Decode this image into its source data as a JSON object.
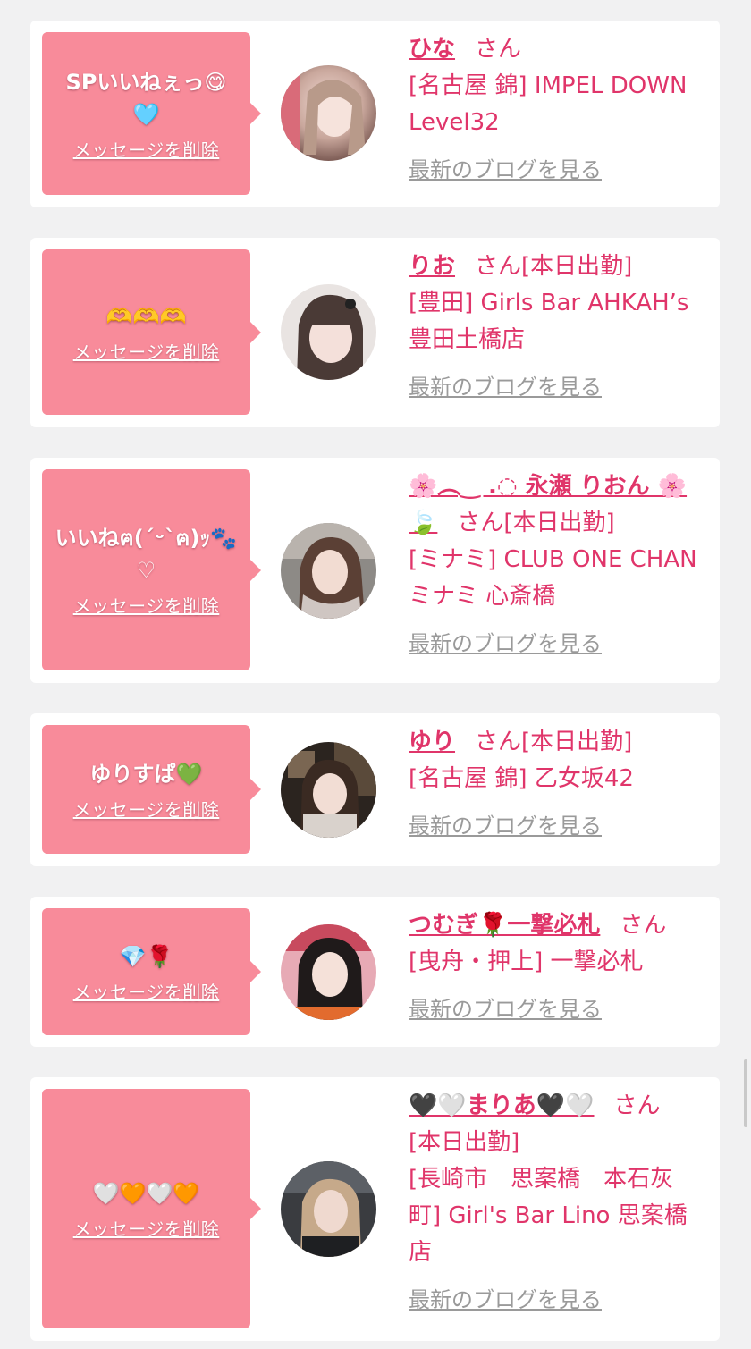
{
  "delete_label": "メッセージを削除",
  "blog_label": "最新のブログを見る",
  "san_label": "さん",
  "colors": {
    "accent": "#e0356a",
    "bubble": "#f88b9a",
    "background": "#f1f1f2"
  },
  "items": [
    {
      "message": "SPいいねぇっ😋🩵",
      "name": "ひな",
      "status": "",
      "shop": "[名古屋 錦] IMPEL DOWN Level32"
    },
    {
      "message": "🫶🫶🫶",
      "name": "りお",
      "status": "[本日出勤]",
      "shop": "[豊田] Girls Bar AHKAH’s 豊田土橋店"
    },
    {
      "message": "いいねฅ(´ᵕ`ฅ)ｯ🐾♡",
      "name": "🌸︵‿ .◌ 永瀬 りおん 🌸🍃",
      "status": "[本日出勤]",
      "shop": "[ミナミ] CLUB ONE CHAN ミナミ 心斎橋"
    },
    {
      "message": "ゆりすぱ💚",
      "name": "ゆり",
      "status": "[本日出勤]",
      "shop": "[名古屋 錦] 乙女坂42"
    },
    {
      "message": "💎🌹",
      "name": "つむぎ🌹一撃必札",
      "status": "",
      "shop": "[曳舟・押上] 一撃必札"
    },
    {
      "message": "🤍🧡🤍🧡",
      "name": "🖤🤍まりあ🖤🤍",
      "status": "[本日出勤]",
      "shop": "[長崎市　思案橋　本石灰町] Girl's Bar Lino 思案橋店"
    }
  ]
}
